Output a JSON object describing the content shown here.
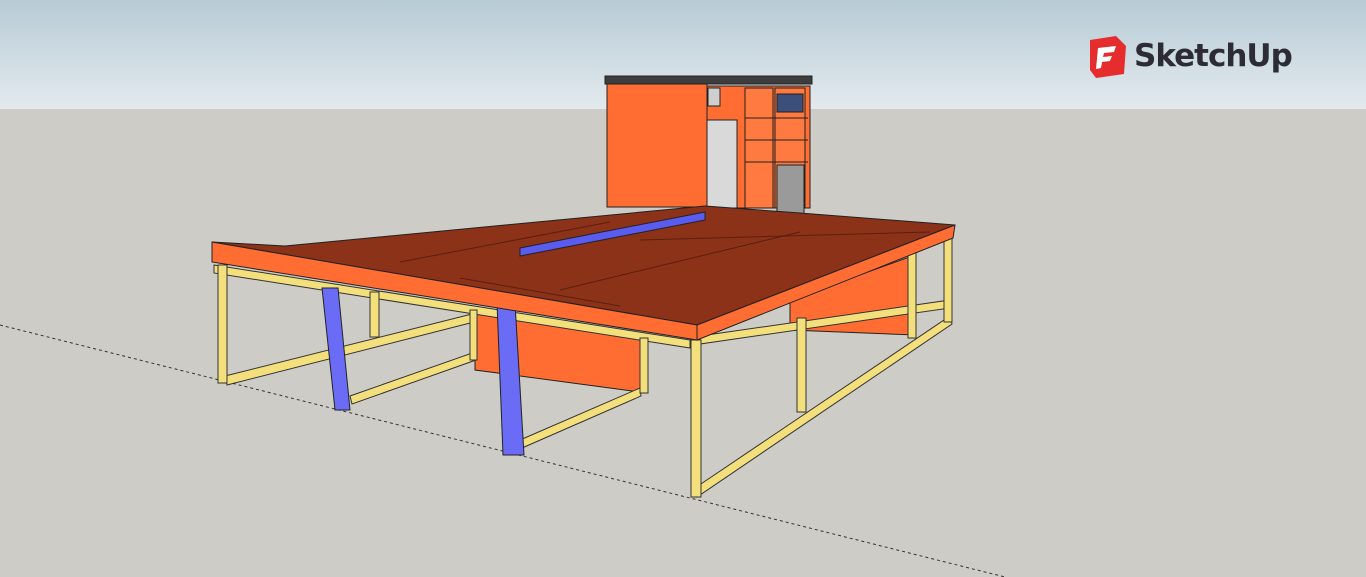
{
  "app": {
    "brand": "SketchUp"
  },
  "colors": {
    "sky_top": "#b7cbd6",
    "sky_bottom": "#e3eaee",
    "ground": "#cdccc7",
    "orange": "#ff6d33",
    "top_surface": "#8b3218",
    "frame": "#f3e07c",
    "blue": "#6a6cf5",
    "logo_red": "#e52d2d"
  }
}
